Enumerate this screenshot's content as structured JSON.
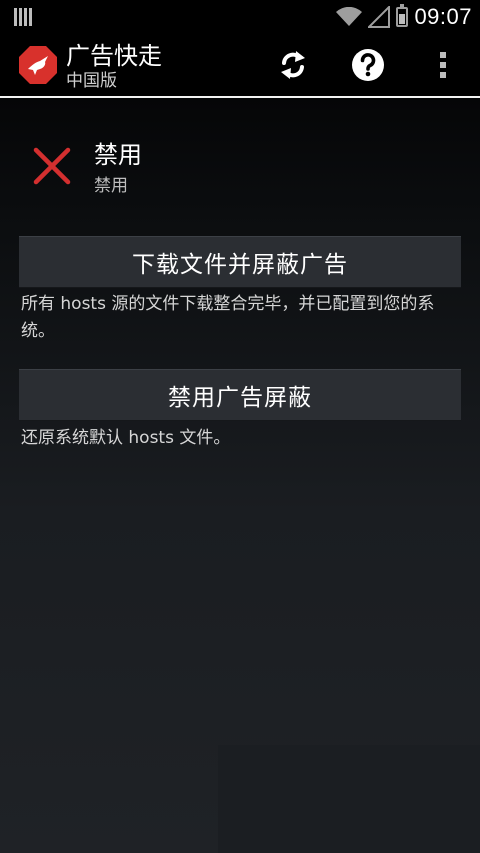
{
  "status_bar": {
    "time": "09:07",
    "icons": [
      "notification-icon",
      "wifi-icon",
      "signal-icon",
      "battery-icon"
    ]
  },
  "app_bar": {
    "title": "广告快走",
    "subtitle": "中国版",
    "actions": [
      "refresh-icon",
      "help-icon",
      "overflow-menu-icon"
    ]
  },
  "status": {
    "icon": "disabled-x-icon",
    "title": "禁用",
    "subtitle": "禁用",
    "icon_color": "#d32f2f"
  },
  "actions": {
    "download_label": "下载文件并屏蔽广告",
    "download_desc": "所有 hosts 源的文件下载整合完毕，并已配置到您的系统。",
    "disable_label": "禁用广告屏蔽",
    "disable_desc": "还原系统默认 hosts 文件。"
  },
  "colors": {
    "logo_red": "#d8312c",
    "button_bg": "#2b2e33",
    "divider": "#f2f2f2"
  }
}
